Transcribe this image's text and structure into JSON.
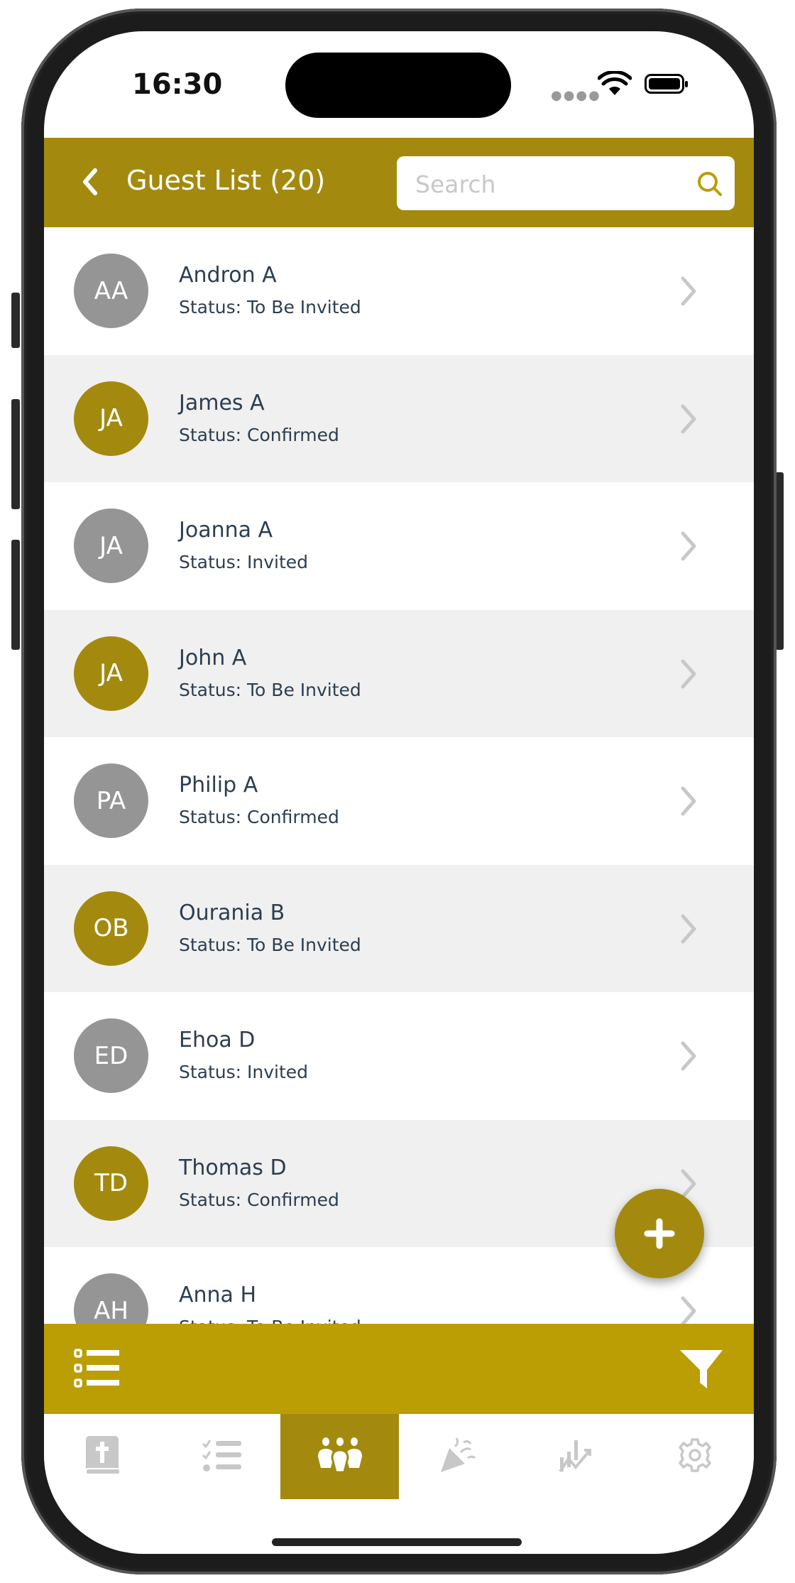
{
  "status_bar": {
    "time": "16:30",
    "signal_icon": "dots-icon",
    "wifi_icon": "wifi-icon",
    "battery_icon": "battery-icon"
  },
  "header": {
    "title": "Guest List (20)",
    "back_icon": "chevron-left-icon",
    "search": {
      "placeholder": "Search",
      "value": ""
    }
  },
  "colors": {
    "header": "#a38a0e",
    "toolbar": "#bb9d04",
    "avatar_gold": "#a38a0e",
    "avatar_gray": "#959595",
    "alt_row": "#f0f0f0",
    "text": "#2c3e50"
  },
  "guests": [
    {
      "initials": "AA",
      "name": "Andron A",
      "status": "Status: To Be Invited",
      "color": "gray"
    },
    {
      "initials": "JA",
      "name": "James A",
      "status": "Status: Confirmed",
      "color": "gold"
    },
    {
      "initials": "JA",
      "name": "Joanna A",
      "status": "Status: Invited",
      "color": "gray"
    },
    {
      "initials": "JA",
      "name": "John A",
      "status": "Status: To Be Invited",
      "color": "gold"
    },
    {
      "initials": "PA",
      "name": "Philip A",
      "status": "Status: Confirmed",
      "color": "gray"
    },
    {
      "initials": "OB",
      "name": "Ourania B",
      "status": "Status: To Be Invited",
      "color": "gold"
    },
    {
      "initials": "ED",
      "name": "Ehoa D",
      "status": "Status: Invited",
      "color": "gray"
    },
    {
      "initials": "TD",
      "name": "Thomas D",
      "status": "Status: Confirmed",
      "color": "gold"
    },
    {
      "initials": "AH",
      "name": "Anna H",
      "status": "Status: To Be Invited",
      "color": "gray"
    }
  ],
  "fab": {
    "icon": "plus-icon"
  },
  "toolbar": {
    "left_icon": "list-icon",
    "right_icon": "filter-icon"
  },
  "tabs": [
    {
      "icon": "bible-icon",
      "active": false
    },
    {
      "icon": "checklist-icon",
      "active": false
    },
    {
      "icon": "guests-icon",
      "active": true
    },
    {
      "icon": "party-popper-icon",
      "active": false
    },
    {
      "icon": "chart-icon",
      "active": false
    },
    {
      "icon": "gear-icon",
      "active": false
    }
  ]
}
